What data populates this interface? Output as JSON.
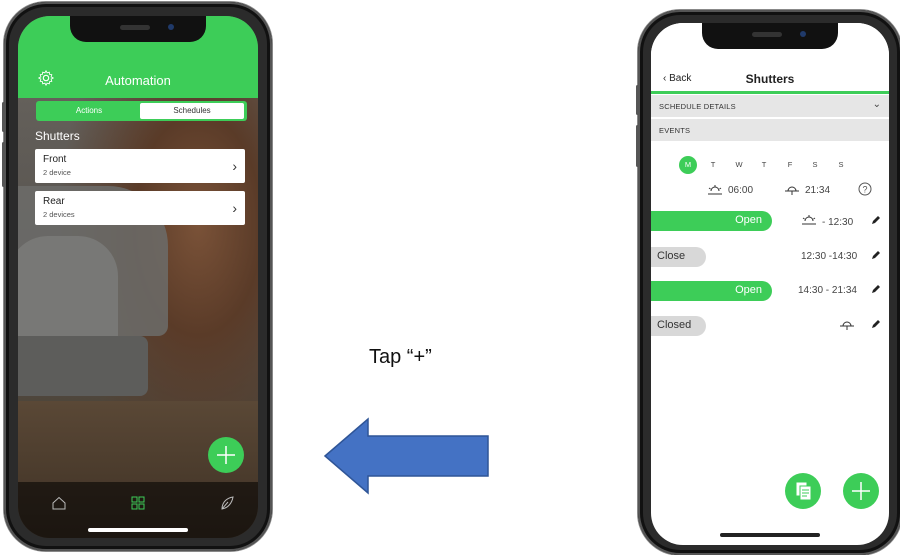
{
  "left_screen": {
    "title": "Automation",
    "segments": [
      "Actions",
      "Schedules"
    ],
    "section": "Shutters",
    "items": [
      {
        "title": "Front",
        "subtitle": "2 device"
      },
      {
        "title": "Rear",
        "subtitle": "2 devices"
      }
    ],
    "accent": "#3dcd58"
  },
  "right_screen": {
    "back_label": "Back",
    "title": "Shutters",
    "schedule_details_label": "SCHEDULE DETAILS",
    "events_label": "EVENTS",
    "days": [
      "M",
      "T",
      "W",
      "T",
      "F",
      "S",
      "S"
    ],
    "selected_day": "M",
    "sunrise_time": "06:00",
    "sunset_time": "21:34",
    "events": [
      {
        "state": "Open",
        "time": "- 12:30"
      },
      {
        "state": "Close",
        "time": "12:30 -14:30"
      },
      {
        "state": "Open",
        "time": "14:30 - 21:34"
      },
      {
        "state": "Closed",
        "time": ""
      }
    ]
  },
  "annotation": "Tap “+”",
  "arrow_color": "#4472c4"
}
